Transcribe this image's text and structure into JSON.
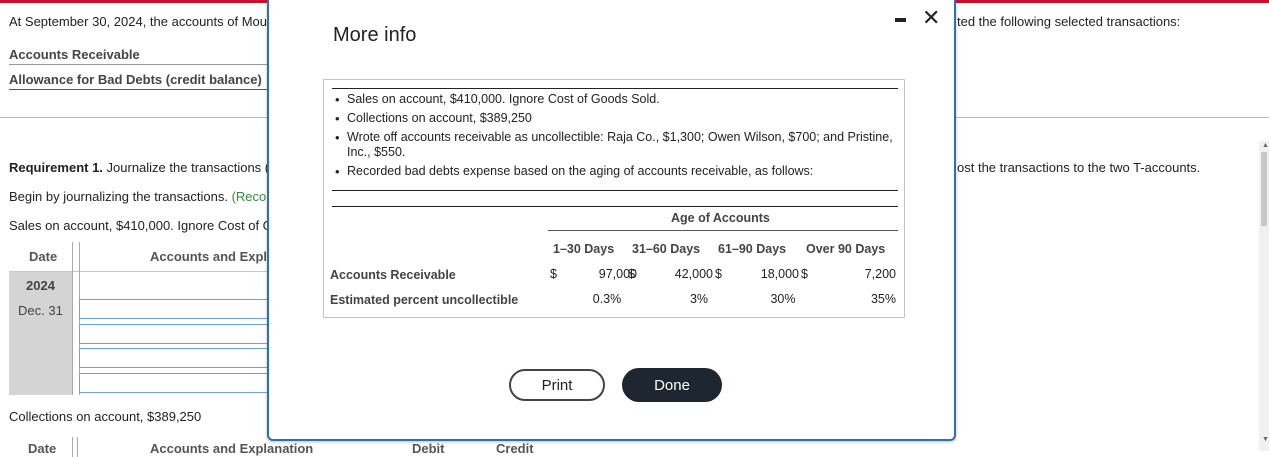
{
  "background": {
    "intro_left": "At September 30, 2024, the accounts of Mou",
    "intro_right": "ted the following selected transactions:",
    "accounts_receivable": "Accounts Receivable",
    "allowance": "Allowance for Bad Debts (credit balance)",
    "req_bold": "Requirement 1.",
    "req_text": " Journalize the transactions (",
    "req_right": "ost the transactions to the two T-accounts.",
    "begin_text": "Begin by journalizing the transactions. ",
    "begin_green": "(Reco",
    "sales_line": "Sales on account, $410,000. Ignore Cost of G",
    "table1": {
      "col_date": "Date",
      "col_accounts": "Accounts and Expl",
      "year": "2024",
      "date": "Dec. 31"
    },
    "collections_line": "Collections on account, $389,250",
    "table2": {
      "col_date": "Date",
      "col_accounts": "Accounts and Explanation",
      "col_debit": "Debit",
      "col_credit": "Credit"
    }
  },
  "modal": {
    "title": "More info",
    "bullets": [
      "Sales on account, $410,000. Ignore Cost of Goods Sold.",
      "Collections on account, $389,250",
      "Wrote off accounts receivable as uncollectible: Raja Co., $1,300; Owen Wilson, $700; and Pristine, Inc., $550.",
      "Recorded bad debts expense based on the aging of accounts receivable, as follows:"
    ],
    "aging": {
      "group_header": "Age of Accounts",
      "columns": [
        "1–30 Days",
        "31–60 Days",
        "61–90 Days",
        "Over 90 Days"
      ],
      "rows": [
        {
          "label": "Accounts Receivable",
          "currency": [
            "$",
            "$",
            "$",
            "$"
          ],
          "values": [
            "97,000",
            "42,000",
            "18,000",
            "7,200"
          ]
        },
        {
          "label": "Estimated percent uncollectible",
          "values": [
            "0.3%",
            "3%",
            "30%",
            "35%"
          ]
        }
      ]
    },
    "print_label": "Print",
    "done_label": "Done"
  }
}
